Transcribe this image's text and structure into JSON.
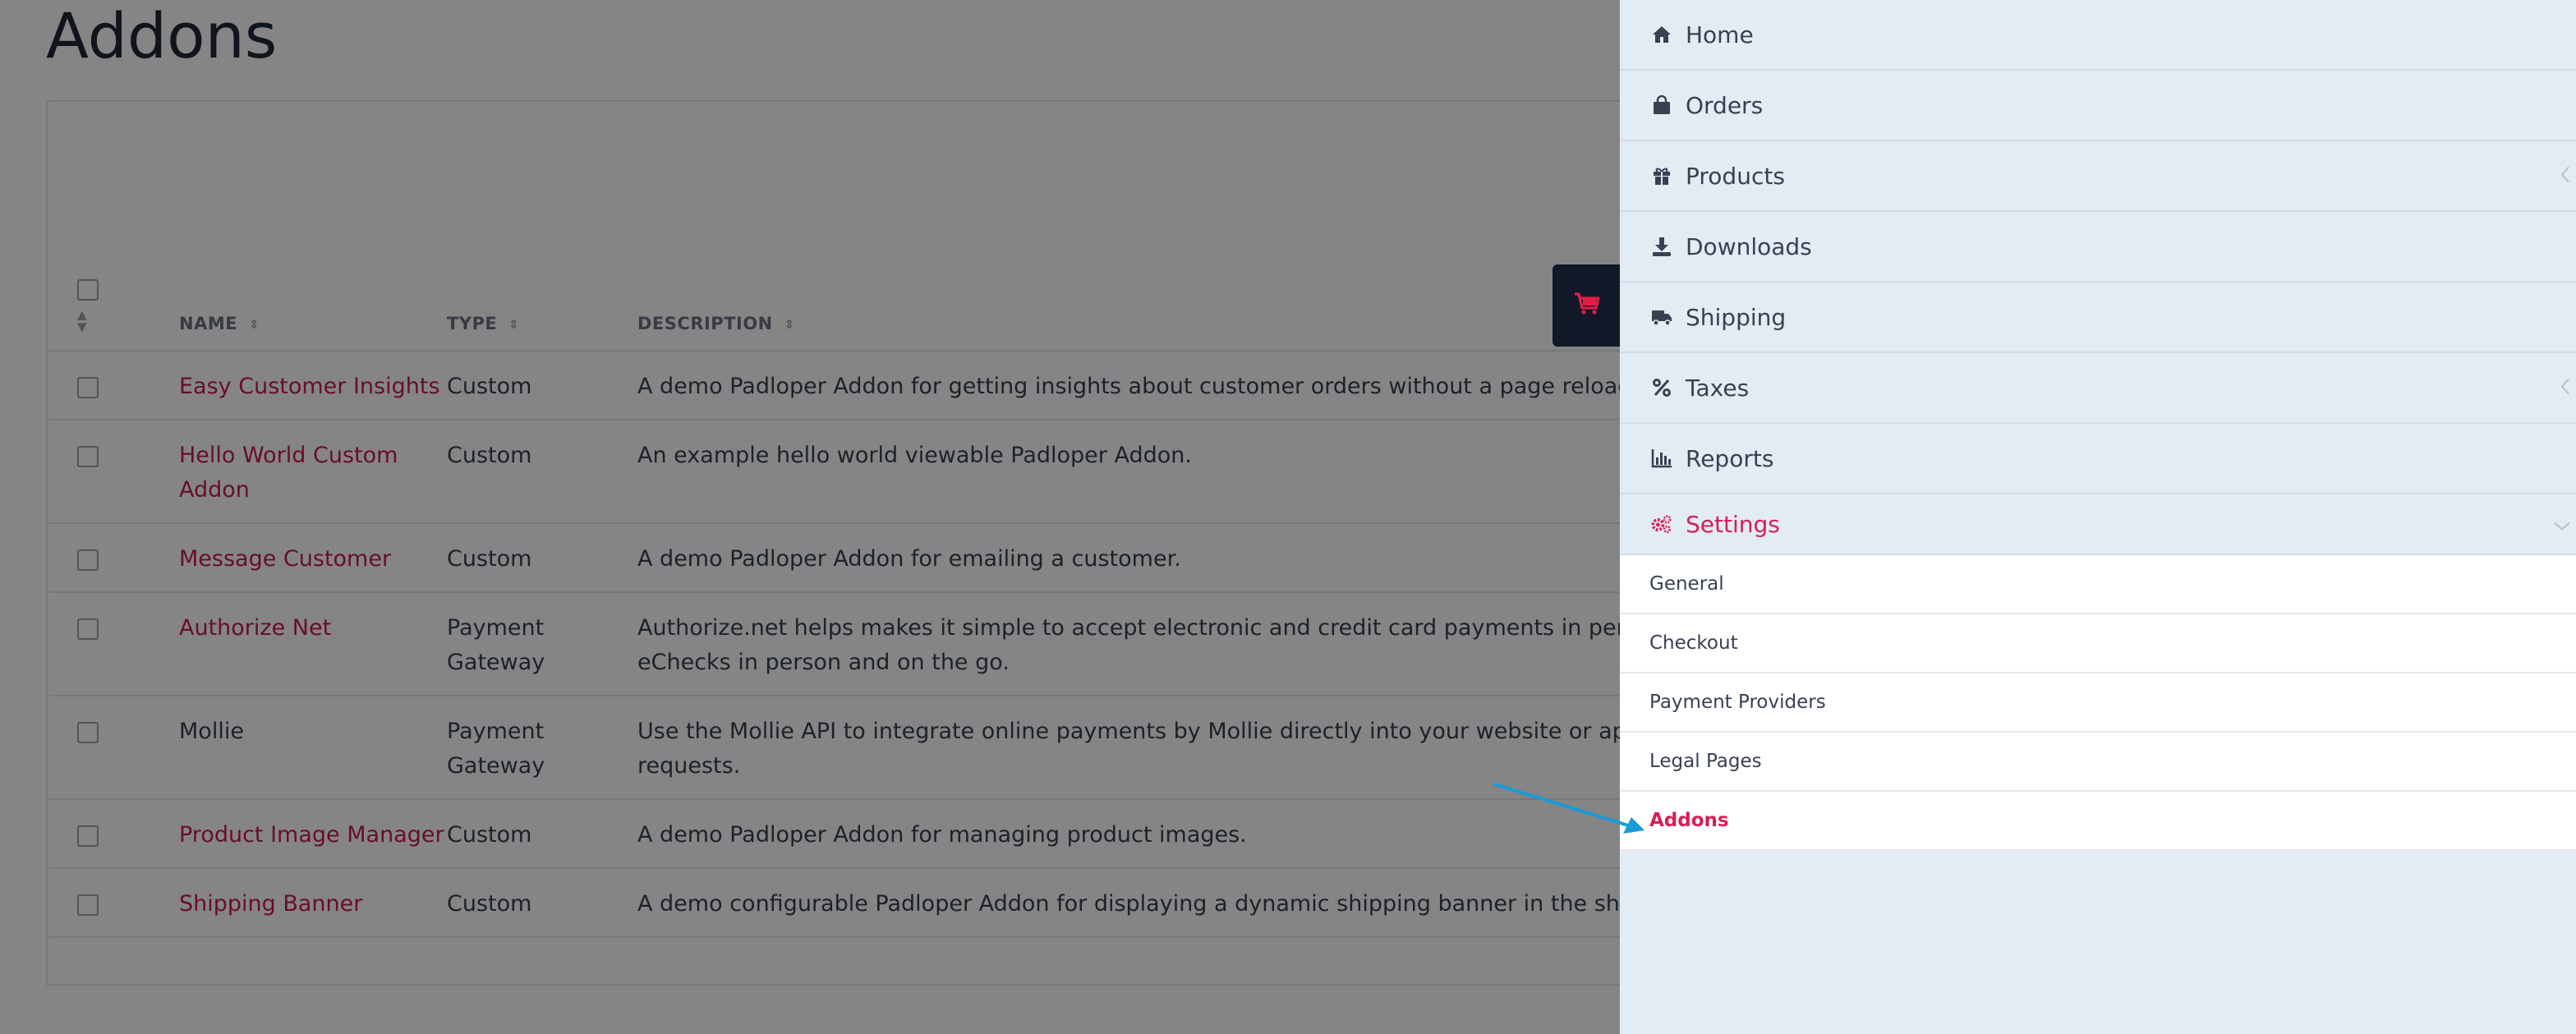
{
  "page": {
    "title": "Addons"
  },
  "table": {
    "headers": {
      "name": "NAME",
      "type": "TYPE",
      "description": "DESCRIPTION"
    },
    "rows": [
      {
        "name": "Easy Customer Insights",
        "linked": true,
        "type": "Custom",
        "description": "A demo Padloper Addon for getting insights about customer orders without a page reload (Ajax)."
      },
      {
        "name": "Hello World Custom Addon",
        "linked": true,
        "type": "Custom",
        "description": "An example hello world viewable Padloper Addon."
      },
      {
        "name": "Message Customer",
        "linked": true,
        "type": "Custom",
        "description": "A demo Padloper Addon for emailing a customer."
      },
      {
        "name": "Authorize Net",
        "linked": true,
        "type": "Payment Gateway",
        "description": "Authorize.net helps makes it simple to accept electronic and credit card payments in person, online payments, and eChecks in person and on the go."
      },
      {
        "name": "Mollie",
        "linked": false,
        "type": "Payment Gateway",
        "description": "Use the Mollie API to integrate online payments by Mollie directly into your website or app. Mollie a by sending HTTP requests."
      },
      {
        "name": "Product Image Manager",
        "linked": true,
        "type": "Custom",
        "description": "A demo Padloper Addon for managing product images."
      },
      {
        "name": "Shipping Banner",
        "linked": true,
        "type": "Custom",
        "description": "A demo configurable Padloper Addon for displaying a dynamic shipping banner in the shop fronten"
      }
    ]
  },
  "sidebar": {
    "items": [
      {
        "label": "Home",
        "icon": "home-icon"
      },
      {
        "label": "Orders",
        "icon": "shopping-bag-icon"
      },
      {
        "label": "Products",
        "icon": "gift-icon",
        "expandable": true
      },
      {
        "label": "Downloads",
        "icon": "download-icon"
      },
      {
        "label": "Shipping",
        "icon": "truck-icon"
      },
      {
        "label": "Taxes",
        "icon": "percent-icon",
        "expandable": true
      },
      {
        "label": "Reports",
        "icon": "bar-chart-icon"
      },
      {
        "label": "Settings",
        "icon": "gears-icon",
        "expanded": true,
        "active": true
      }
    ],
    "settings_sub": [
      {
        "label": "General"
      },
      {
        "label": "Checkout"
      },
      {
        "label": "Payment Providers"
      },
      {
        "label": "Legal Pages"
      },
      {
        "label": "Addons",
        "active": true
      }
    ]
  },
  "colors": {
    "accent": "#d61f54",
    "link": "#c81e4a",
    "sidebar_bg": "#e3ebf3",
    "arrow": "#1a9bd7",
    "cart_button": "#111827"
  }
}
